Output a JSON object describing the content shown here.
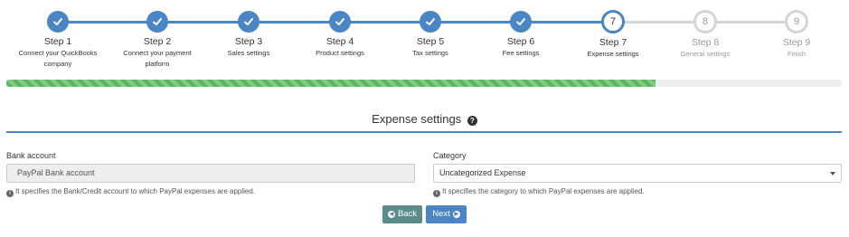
{
  "wizard": {
    "steps": [
      {
        "number": "1",
        "title": "Step 1",
        "desc": [
          "Connect your QuickBooks",
          "company"
        ],
        "state": "done"
      },
      {
        "number": "2",
        "title": "Step 2",
        "desc": [
          "Connect your payment",
          "platform"
        ],
        "state": "done"
      },
      {
        "number": "3",
        "title": "Step 3",
        "desc": [
          "Sales settings"
        ],
        "state": "done"
      },
      {
        "number": "4",
        "title": "Step 4",
        "desc": [
          "Product settings"
        ],
        "state": "done"
      },
      {
        "number": "5",
        "title": "Step 5",
        "desc": [
          "Tax settings"
        ],
        "state": "done"
      },
      {
        "number": "6",
        "title": "Step 6",
        "desc": [
          "Fee settings"
        ],
        "state": "done"
      },
      {
        "number": "7",
        "title": "Step 7",
        "desc": [
          "Expense settings"
        ],
        "state": "current"
      },
      {
        "number": "8",
        "title": "Step 8",
        "desc": [
          "General settings"
        ],
        "state": "todo"
      },
      {
        "number": "9",
        "title": "Step 9",
        "desc": [
          "Finish"
        ],
        "state": "todo"
      }
    ],
    "progress_fraction": 0.777
  },
  "section": {
    "title": "Expense settings",
    "help_icon": "question-circle-icon"
  },
  "form": {
    "bank_account": {
      "label": "Bank account",
      "value": "PayPal Bank account",
      "help": "It specifies the Bank/Credit account to which PayPal expenses are applied."
    },
    "category": {
      "label": "Category",
      "value": "Uncategorized Expense",
      "help": "It specifies the category to which PayPal expenses are applied."
    }
  },
  "buttons": {
    "back_label": "Back",
    "next_label": "Next"
  },
  "colors": {
    "primary": "#4a86c5",
    "back_button": "#5b8c8c",
    "progress": "#5cb85c",
    "inactive": "#d5d5d5"
  }
}
